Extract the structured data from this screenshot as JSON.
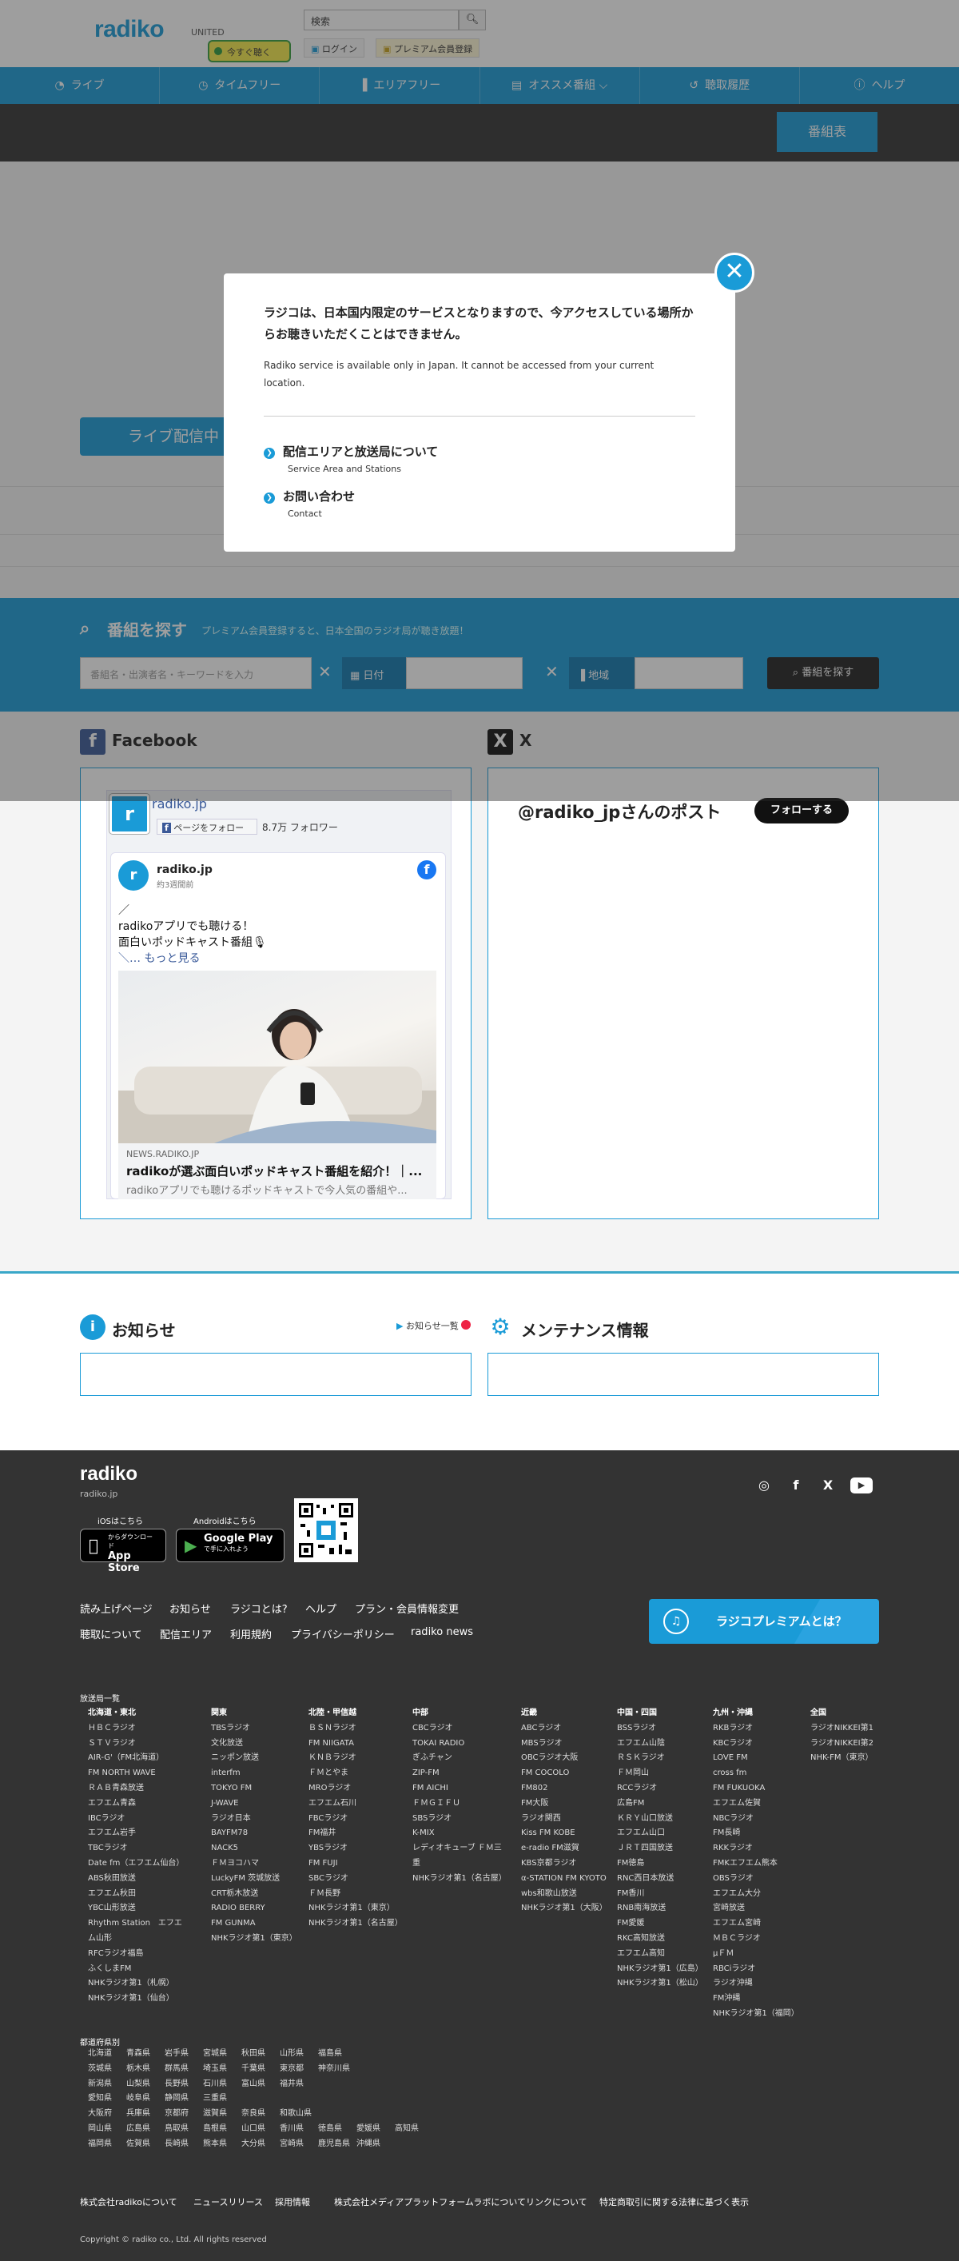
{
  "header": {
    "logo": "radiko",
    "area": "UNITED",
    "search_placeholder": "検索",
    "search_icon": "search-icon",
    "login": "ログイン",
    "premium_register": "プレミアム会員登録",
    "now_listen": "今すぐ聴く",
    "program_table": "番組表"
  },
  "nav": [
    {
      "label": "ライブ",
      "icon": "wifi-icon"
    },
    {
      "label": "タイムフリー",
      "icon": "clock-icon"
    },
    {
      "label": "エリアフリー",
      "icon": "signal-icon"
    },
    {
      "label": "オススメ番組",
      "icon": "tag-icon"
    },
    {
      "label": "聴取履歴",
      "icon": "history-icon"
    },
    {
      "label": "ヘルプ",
      "icon": "help-icon"
    }
  ],
  "main": {
    "live_button": "ライブ配信中"
  },
  "program_search": {
    "title": "番組を探す",
    "subtitle": "プレミアム会員登録すると、日本全国のラジオ局が聴き放題！",
    "keyword_placeholder": "番組名・出演者名・キーワードを入力",
    "date_label": "日付",
    "region_label": "地域",
    "search_button": "番組を探す"
  },
  "social": {
    "facebook_title": "Facebook",
    "x_title": "X",
    "x_handle": "@radiko_jpさんのポスト",
    "x_follow": "フォローする",
    "fb_page_name": "radiko.jp",
    "fb_follow": "ページをフォロー",
    "fb_followers": "8.7万 フォロワー",
    "fb_post_author": "radiko.jp",
    "fb_post_time": "約3週間前",
    "fb_post_lines": [
      "／",
      "radikoアプリでも聴ける！",
      "面白いポッドキャスト番組🎙",
      "＼… もっと見る"
    ],
    "fb_link_source": "NEWS.RADIKO.JP",
    "fb_link_title": "radikoが選ぶ面白いポッドキャスト番組を紹介！｜...",
    "fb_link_desc": "radikoアプリでも聴けるポッドキャストで今人気の番組や..."
  },
  "info": {
    "news_title": "お知らせ",
    "news_all": "お知らせ一覧",
    "maintenance_title": "メンテナンス情報"
  },
  "footer": {
    "logo": "radiko",
    "site": "radiko.jp",
    "ios_label": "iOSはこちら",
    "android_label": "Androidはこちら",
    "appstore_1": "App Store",
    "appstore_2": "からダウンロード",
    "googleplay_1": "Google Play",
    "googleplay_2": "で手に入れよう",
    "links_row1": [
      "読み上げページ",
      "お知らせ",
      "ラジコとは?",
      "ヘルプ",
      "プラン・会員情報変更"
    ],
    "links_row2": [
      "聴取について",
      "配信エリア",
      "利用規約",
      "プライバシーポリシー",
      "radiko news"
    ],
    "premium_banner": "ラジコプレミアムとは？",
    "stations_title": "放送局一覧",
    "stations": [
      {
        "region": "北海道・東北",
        "items": [
          "ＨＢＣラジオ",
          "ＳＴＶラジオ",
          "AIR-G'（FM北海道）",
          "FM NORTH WAVE",
          "ＲＡＢ青森放送",
          "エフエム青森",
          "IBCラジオ",
          "エフエム岩手",
          "TBCラジオ",
          "Date fm（エフエム仙台）",
          "ABS秋田放送",
          "エフエム秋田",
          "YBC山形放送",
          "Rhythm Station　エフエム山形",
          "RFCラジオ福島",
          "ふくしまFM",
          "NHKラジオ第1（札幌）",
          "NHKラジオ第1（仙台）"
        ]
      },
      {
        "region": "関東",
        "items": [
          "TBSラジオ",
          "文化放送",
          "ニッポン放送",
          "interfm",
          "TOKYO FM",
          "J-WAVE",
          "ラジオ日本",
          "BAYFM78",
          "NACK5",
          "ＦＭヨコハマ",
          "LuckyFM 茨城放送",
          "CRT栃木放送",
          "RADIO BERRY",
          "FM GUNMA",
          "NHKラジオ第1（東京）"
        ]
      },
      {
        "region": "北陸・甲信越",
        "items": [
          "ＢＳＮラジオ",
          "FM NIIGATA",
          "ＫＮＢラジオ",
          "ＦＭとやま",
          "MROラジオ",
          "エフエム石川",
          "FBCラジオ",
          "FM福井",
          "YBSラジオ",
          "FM FUJI",
          "SBCラジオ",
          "ＦＭ長野",
          "NHKラジオ第1（東京）",
          "NHKラジオ第1（名古屋）"
        ]
      },
      {
        "region": "中部",
        "items": [
          "CBCラジオ",
          "TOKAI RADIO",
          "ぎふチャン",
          "ZIP-FM",
          "FM AICHI",
          "ＦＭＧＩＦＵ",
          "SBSラジオ",
          "K-MIX",
          "レディオキューブ ＦＭ三重",
          "NHKラジオ第1（名古屋）"
        ]
      },
      {
        "region": "近畿",
        "items": [
          "ABCラジオ",
          "MBSラジオ",
          "OBCラジオ大阪",
          "FM COCOLO",
          "FM802",
          "FM大阪",
          "ラジオ関西",
          "Kiss FM KOBE",
          "e-radio FM滋賀",
          "KBS京都ラジオ",
          "α-STATION FM KYOTO",
          "wbs和歌山放送",
          "NHKラジオ第1（大阪）"
        ]
      },
      {
        "region": "中国・四国",
        "items": [
          "BSSラジオ",
          "エフエム山陰",
          "ＲＳＫラジオ",
          "ＦＭ岡山",
          "RCCラジオ",
          "広島FM",
          "ＫＲＹ山口放送",
          "エフエム山口",
          "ＪＲＴ四国放送",
          "FM徳島",
          "RNC西日本放送",
          "FM香川",
          "RNB南海放送",
          "FM愛媛",
          "RKC高知放送",
          "エフエム高知",
          "NHKラジオ第1（広島）",
          "NHKラジオ第1（松山）"
        ]
      },
      {
        "region": "九州・沖縄",
        "items": [
          "RKBラジオ",
          "KBCラジオ",
          "LOVE FM",
          "cross fm",
          "FM FUKUOKA",
          "エフエム佐賀",
          "NBCラジオ",
          "FM長崎",
          "RKKラジオ",
          "FMKエフエム熊本",
          "OBSラジオ",
          "エフエム大分",
          "宮崎放送",
          "エフエム宮崎",
          "ＭＢＣラジオ",
          "μＦＭ",
          "RBCiラジオ",
          "ラジオ沖縄",
          "FM沖縄",
          "NHKラジオ第1（福岡）"
        ]
      },
      {
        "region": "全国",
        "items": [
          "ラジオNIKKEI第1",
          "ラジオNIKKEI第2",
          "NHK-FM（東京）"
        ]
      }
    ],
    "prefectures_title": "都道府県別",
    "prefectures": [
      [
        "北海道",
        "青森県",
        "岩手県",
        "宮城県",
        "秋田県",
        "山形県",
        "福島県"
      ],
      [
        "茨城県",
        "栃木県",
        "群馬県",
        "埼玉県",
        "千葉県",
        "東京都",
        "神奈川県"
      ],
      [
        "新潟県",
        "山梨県",
        "長野県",
        "石川県",
        "富山県",
        "福井県"
      ],
      [
        "愛知県",
        "岐阜県",
        "静岡県",
        "三重県"
      ],
      [
        "大阪府",
        "兵庫県",
        "京都府",
        "滋賀県",
        "奈良県",
        "和歌山県"
      ],
      [
        "岡山県",
        "広島県",
        "鳥取県",
        "島根県",
        "山口県",
        "香川県",
        "徳島県",
        "愛媛県",
        "高知県"
      ],
      [
        "福岡県",
        "佐賀県",
        "長崎県",
        "熊本県",
        "大分県",
        "宮崎県",
        "鹿児島県",
        "沖縄県"
      ]
    ],
    "bottom_links": [
      "株式会社radikoについて",
      "ニュースリリース",
      "採用情報",
      "株式会社メディアプラットフォームラボについて",
      "リンクについて",
      "特定商取引に関する法律に基づく表示"
    ],
    "copyright": "Copyright © radiko co., Ltd. All rights reserved"
  },
  "modal": {
    "message_jp": "ラジコは、日本国内限定のサービスとなりますので、今アクセスしている場所からお聴きいただくことはできません。",
    "message_en": "Radiko service is available only in Japan. It cannot be accessed from your current location.",
    "link1_title": "配信エリアと放送局について",
    "link1_sub": "Service Area and Stations",
    "link2_title": "お問い合わせ",
    "link2_sub": "Contact",
    "close_icon": "close-icon"
  },
  "colors": {
    "brand": "#1a9bd7",
    "dark": "#333333",
    "badge": "#f5e94c"
  }
}
